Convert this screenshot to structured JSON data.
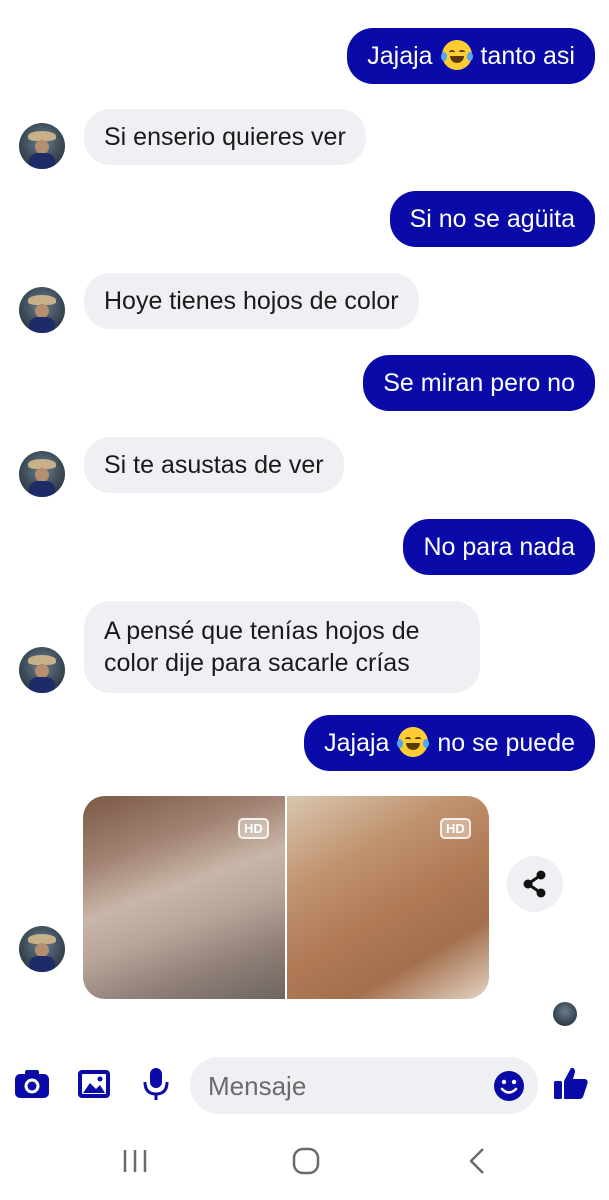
{
  "colors": {
    "accent": "#0a0aa8",
    "received_bubble": "#eef0f4"
  },
  "messages": [
    {
      "dir": "sent",
      "text_before": "Jajaja",
      "emoji": "face-with-tears-of-joy",
      "text_after": "tanto asi"
    },
    {
      "dir": "received",
      "text": "Si enserio quieres ver"
    },
    {
      "dir": "sent",
      "text": "Si no se agüita"
    },
    {
      "dir": "received",
      "text": "Hoye tienes hojos de color"
    },
    {
      "dir": "sent",
      "text": "Se miran pero no"
    },
    {
      "dir": "received",
      "text": "Si te asustas de ver"
    },
    {
      "dir": "sent",
      "text": "No para nada"
    },
    {
      "dir": "received",
      "text": "A pensé que tenías hojos de color dije para sacarle crías"
    },
    {
      "dir": "sent",
      "text_before": "Jajaja",
      "emoji": "face-with-tears-of-joy",
      "text_after": "no se puede"
    }
  ],
  "photos": {
    "badge": "HD",
    "count": 2
  },
  "composer": {
    "placeholder": "Mensaje",
    "icons": [
      "camera-icon",
      "gallery-icon",
      "microphone-icon",
      "emoji-icon",
      "like-icon"
    ]
  },
  "navigation": {
    "icons": [
      "recent-apps-icon",
      "home-icon",
      "back-icon"
    ]
  }
}
